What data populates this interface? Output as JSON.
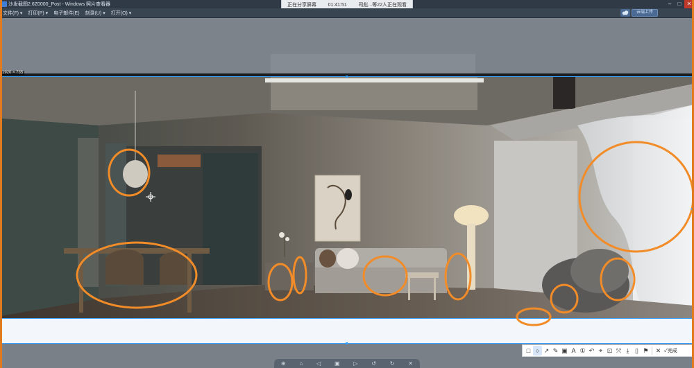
{
  "window": {
    "title": "沙发截图2.6Z0000_Post - Windows 照片查看器",
    "minimize": "–",
    "maximize": "□",
    "close": "✕"
  },
  "share_bar": {
    "status": "正在分享屏幕",
    "timer": "01:41:51",
    "viewers": "司彪...等22人正在观看"
  },
  "menu": {
    "items": [
      "文件(F) ▾",
      "打印(P) ▾",
      "电子邮件(E)",
      "刻录(U) ▾",
      "打开(O) ▾"
    ],
    "upload_label": "云端上传"
  },
  "selection": {
    "size_label": "1920 × 735"
  },
  "toolbar": {
    "tools": [
      {
        "name": "rectangle-tool",
        "glyph": "□"
      },
      {
        "name": "ellipse-tool",
        "glyph": "○"
      },
      {
        "name": "arrow-tool",
        "glyph": "↗"
      },
      {
        "name": "pen-tool",
        "glyph": "✎"
      },
      {
        "name": "mosaic-tool",
        "glyph": "▣"
      },
      {
        "name": "text-tool",
        "glyph": "A"
      },
      {
        "name": "number-tool",
        "glyph": "①"
      },
      {
        "name": "undo-tool",
        "glyph": "↶"
      },
      {
        "name": "pin-tool",
        "glyph": "⌖"
      },
      {
        "name": "ocr-tool",
        "glyph": "⊡"
      },
      {
        "name": "translate-tool",
        "glyph": "⤧"
      },
      {
        "name": "download-tool",
        "glyph": "⤓"
      },
      {
        "name": "copy-tool",
        "glyph": "▯"
      },
      {
        "name": "bookmark-tool",
        "glyph": "⚑"
      }
    ],
    "cancel_glyph": "✕",
    "done_label": "✓完成"
  },
  "dock": {
    "glyphs": [
      "⊕",
      "⌂",
      "◁",
      "▣",
      "▷",
      "↺",
      "↻",
      "✕"
    ]
  },
  "colors": {
    "annotation": "#f28c28",
    "selection_border": "#3aa0ff"
  }
}
